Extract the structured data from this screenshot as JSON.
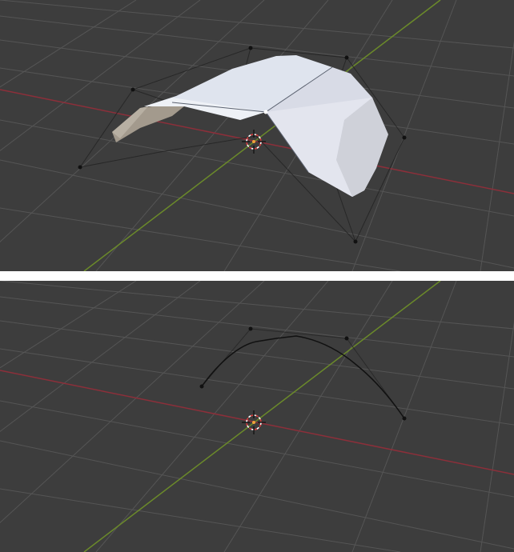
{
  "viewports": [
    {
      "id": "top",
      "content": "nurbs-surface-mesh",
      "colors": {
        "background": "#3d3d3d",
        "grid": "#555555",
        "x_axis": "#8c2f3a",
        "y_axis": "#6b8a2a",
        "surface_light": "#e6ebf2",
        "surface_shadow": "#9e9588",
        "control_point": "#111111"
      }
    },
    {
      "id": "bottom",
      "content": "nurbs-curve",
      "colors": {
        "background": "#3d3d3d",
        "grid": "#555555",
        "x_axis": "#8c2f3a",
        "y_axis": "#6b8a2a",
        "curve": "#111111",
        "control_point": "#111111"
      }
    }
  ],
  "icons": {
    "cursor": "3d-cursor-icon"
  }
}
